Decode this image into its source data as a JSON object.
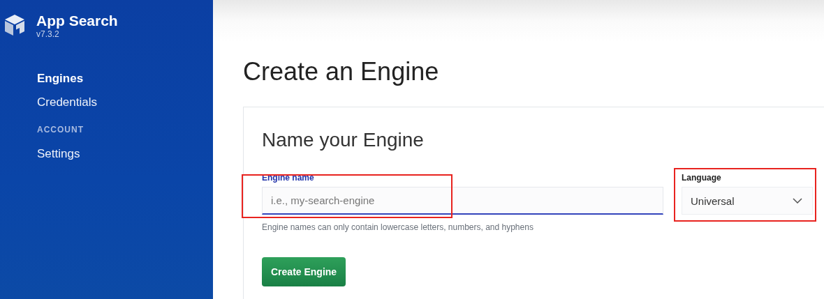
{
  "sidebar": {
    "app_name": "App Search",
    "version": "v7.3.2",
    "items": [
      {
        "label": "Engines",
        "selected": true
      },
      {
        "label": "Credentials",
        "selected": false
      }
    ],
    "sections": [
      {
        "heading": "ACCOUNT",
        "items": [
          {
            "label": "Settings",
            "selected": false
          }
        ]
      }
    ]
  },
  "page": {
    "title": "Create an Engine"
  },
  "card": {
    "title": "Name your Engine",
    "name_field": {
      "label": "Engine name",
      "placeholder": "i.e., my-search-engine",
      "focused": true,
      "help": "Engine names can only contain lowercase letters, numbers, and hyphens"
    },
    "language_field": {
      "label": "Language",
      "value": "Universal"
    },
    "button": "Create Engine"
  }
}
